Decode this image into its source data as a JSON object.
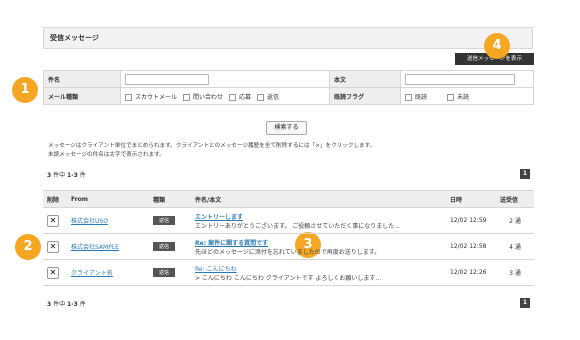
{
  "panel": {
    "title": "受信メッセージ"
  },
  "sent_button": "送信メッセージを表示",
  "badges": [
    "1",
    "2",
    "3",
    "4"
  ],
  "filter": {
    "subject_label": "件名",
    "body_label": "本文",
    "mail_type_label": "メール種類",
    "mail_types": [
      "スカウトメール",
      "問い合わせ",
      "応募",
      "返信"
    ],
    "read_flag_label": "既読フラグ",
    "read_flags": [
      "既読",
      "未読"
    ]
  },
  "search_button": "検索する",
  "notes": [
    "メッセージはクライアント単位でまとめられます。クライアントとのメッセージ履歴を全て削除するには「×」をクリックします。",
    "未読メッセージの件名は太字で表示されます。"
  ],
  "summary": {
    "total": "3",
    "total_suffix": " 件中 ",
    "range": "1-3",
    "range_suffix": " 件"
  },
  "page": "1",
  "columns": {
    "delete": "削除",
    "from": "From",
    "kind": "種類",
    "subject": "件名/本文",
    "date": "日時",
    "count": "送受信"
  },
  "rows": [
    {
      "del": "✕",
      "from": "株式会社USO",
      "kind": "返信",
      "subject": "エントリーします",
      "body": "エントリーありがとうございます。 ご役頼させていただく事になりました...",
      "date": "12/02 12:59",
      "count": "2 通"
    },
    {
      "del": "✕",
      "from": "株式会社SAMPLE",
      "kind": "返信",
      "subject": "Re: 案件に関する質問です",
      "body": "先ほどのメッセージに添付を忘れていましたので再度お送りします。",
      "date": "12/02 12:58",
      "count": "4 通"
    },
    {
      "del": "✕",
      "from": "クライアント名",
      "kind": "返信",
      "subject": "Re: こんにちわ",
      "body": "> こんにちわ こんにちわ クライアントです よろしくお願いします...",
      "date": "12/02 12:26",
      "count": "3 通"
    }
  ],
  "colors": {
    "badge": "#f5a623",
    "link": "#2a7ab8",
    "dark_button": "#333333"
  }
}
